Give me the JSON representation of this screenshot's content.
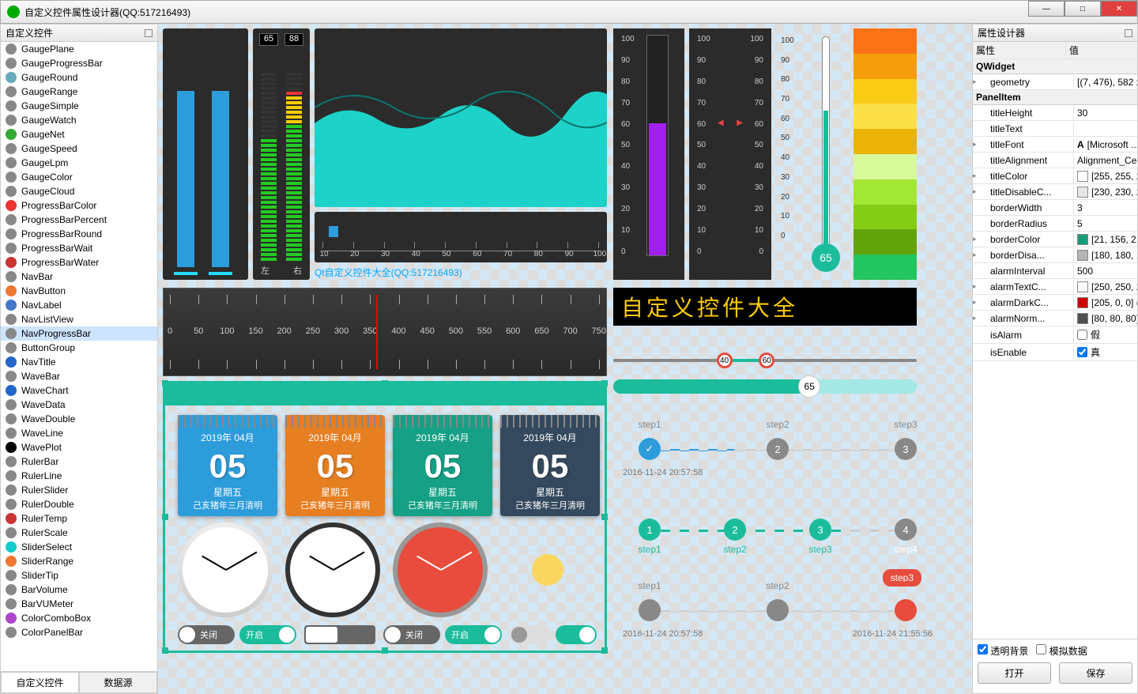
{
  "window": {
    "title": "自定义控件属性设计器(QQ:517216493)"
  },
  "left": {
    "title": "自定义控件",
    "tabs": [
      "自定义控件",
      "数据源"
    ],
    "items": [
      {
        "name": "GaugePlane",
        "color": "#888"
      },
      {
        "name": "GaugeProgressBar",
        "color": "#888"
      },
      {
        "name": "GaugeRound",
        "color": "#6ab"
      },
      {
        "name": "GaugeRange",
        "color": "#888"
      },
      {
        "name": "GaugeSimple",
        "color": "#888"
      },
      {
        "name": "GaugeWatch",
        "color": "#888"
      },
      {
        "name": "GaugeNet",
        "color": "#3a3"
      },
      {
        "name": "GaugeSpeed",
        "color": "#888"
      },
      {
        "name": "GaugeLpm",
        "color": "#888"
      },
      {
        "name": "GaugeColor",
        "color": "#888"
      },
      {
        "name": "GaugeCloud",
        "color": "#888"
      },
      {
        "name": "ProgressBarColor",
        "color": "#e33"
      },
      {
        "name": "ProgressBarPercent",
        "color": "#888"
      },
      {
        "name": "ProgressBarRound",
        "color": "#888"
      },
      {
        "name": "ProgressBarWait",
        "color": "#888"
      },
      {
        "name": "ProgressBarWater",
        "color": "#c33"
      },
      {
        "name": "NavBar",
        "color": "#888"
      },
      {
        "name": "NavButton",
        "color": "#e73"
      },
      {
        "name": "NavLabel",
        "color": "#47c"
      },
      {
        "name": "NavListView",
        "color": "#888"
      },
      {
        "name": "NavProgressBar",
        "color": "#888",
        "selected": true
      },
      {
        "name": "ButtonGroup",
        "color": "#888"
      },
      {
        "name": "NavTitle",
        "color": "#26c"
      },
      {
        "name": "WaveBar",
        "color": "#888"
      },
      {
        "name": "WaveChart",
        "color": "#26c"
      },
      {
        "name": "WaveData",
        "color": "#888"
      },
      {
        "name": "WaveDouble",
        "color": "#888"
      },
      {
        "name": "WaveLine",
        "color": "#888"
      },
      {
        "name": "WavePlot",
        "color": "#000"
      },
      {
        "name": "RulerBar",
        "color": "#888"
      },
      {
        "name": "RulerLine",
        "color": "#888"
      },
      {
        "name": "RulerSlider",
        "color": "#888"
      },
      {
        "name": "RulerDouble",
        "color": "#888"
      },
      {
        "name": "RulerTemp",
        "color": "#c33"
      },
      {
        "name": "RulerScale",
        "color": "#888"
      },
      {
        "name": "SliderSelect",
        "color": "#1cc"
      },
      {
        "name": "SliderRange",
        "color": "#e73"
      },
      {
        "name": "SliderTip",
        "color": "#888"
      },
      {
        "name": "BarVolume",
        "color": "#888"
      },
      {
        "name": "BarVUMeter",
        "color": "#888"
      },
      {
        "name": "ColorComboBox",
        "color": "#a4c"
      },
      {
        "name": "ColorPanelBar",
        "color": "#888"
      }
    ]
  },
  "canvas": {
    "vu": {
      "l": "65",
      "r": "88",
      "lbl_l": "左",
      "lbl_r": "右"
    },
    "wave_caption": "Qt自定义控件大全(QQ:517216493)",
    "ruler_ticks": [
      "10",
      "20",
      "30",
      "40",
      "50",
      "60",
      "70",
      "80",
      "90",
      "100"
    ],
    "vscale_ticks": [
      "100",
      "90",
      "80",
      "70",
      "60",
      "50",
      "40",
      "30",
      "20",
      "10",
      "0"
    ],
    "thermo_val": "65",
    "big_ruler": [
      "0",
      "50",
      "100",
      "150",
      "200",
      "250",
      "300",
      "350",
      "400",
      "450",
      "500",
      "550",
      "600",
      "650",
      "700",
      "750"
    ],
    "led_text": "自定义控件大全",
    "range": {
      "a": "40",
      "b": "60"
    },
    "prog": "65",
    "steps1": {
      "labels": [
        "step1",
        "step2",
        "step3"
      ],
      "ts": "2016-11-24 20:57:58"
    },
    "steps2": {
      "labels": [
        "step1",
        "step2",
        "step3",
        "step4"
      ]
    },
    "steps3": {
      "labels": [
        "step1",
        "step2",
        "step3"
      ],
      "bubble": "step3",
      "ts_l": "2016-11-24 20:57:58",
      "ts_r": "2016-11-24 21:55:56"
    },
    "cal": {
      "ym": "2019年 04月",
      "day": "05",
      "wd": "星期五",
      "lunar": "己亥猪年三月清明"
    },
    "switch": {
      "off": "关闭",
      "on": "开启"
    }
  },
  "right": {
    "title": "属性设计器",
    "header": {
      "k": "属性",
      "v": "值"
    },
    "groups": [
      {
        "name": "QWidget",
        "rows": [
          {
            "k": "geometry",
            "v": "[(7, 476), 582 x ...",
            "exp": true
          }
        ]
      },
      {
        "name": "PanelItem",
        "rows": [
          {
            "k": "titleHeight",
            "v": "30"
          },
          {
            "k": "titleText",
            "v": ""
          },
          {
            "k": "titleFont",
            "v": "[Microsoft ...",
            "exp": true,
            "icon": "A"
          },
          {
            "k": "titleAlignment",
            "v": "Alignment_Center"
          },
          {
            "k": "titleColor",
            "v": "[255, 255, 2...",
            "exp": true,
            "swatch": "#ffffff"
          },
          {
            "k": "titleDisableC...",
            "v": "[230, 230, 2...",
            "exp": true,
            "swatch": "#e6e6e6"
          },
          {
            "k": "borderWidth",
            "v": "3"
          },
          {
            "k": "borderRadius",
            "v": "5"
          },
          {
            "k": "borderColor",
            "v": "[21, 156, 2...",
            "exp": true,
            "swatch": "#159c77"
          },
          {
            "k": "borderDisa...",
            "v": "[180, 180, 1...",
            "exp": true,
            "swatch": "#b4b4b4"
          },
          {
            "k": "alarmInterval",
            "v": "500"
          },
          {
            "k": "alarmTextC...",
            "v": "[250, 250, 2...",
            "exp": true,
            "swatch": "#fafafa"
          },
          {
            "k": "alarmDarkC...",
            "v": "[205, 0, 0] (...",
            "exp": true,
            "swatch": "#cd0000"
          },
          {
            "k": "alarmNorm...",
            "v": "[80, 80, 80] ...",
            "exp": true,
            "swatch": "#505050"
          },
          {
            "k": "isAlarm",
            "v": "假",
            "chk": false
          },
          {
            "k": "isEnable",
            "v": "真",
            "chk": true
          }
        ]
      }
    ],
    "footer": {
      "transparent": "透明背景",
      "mock": "模拟数据",
      "open": "打开",
      "save": "保存"
    }
  }
}
